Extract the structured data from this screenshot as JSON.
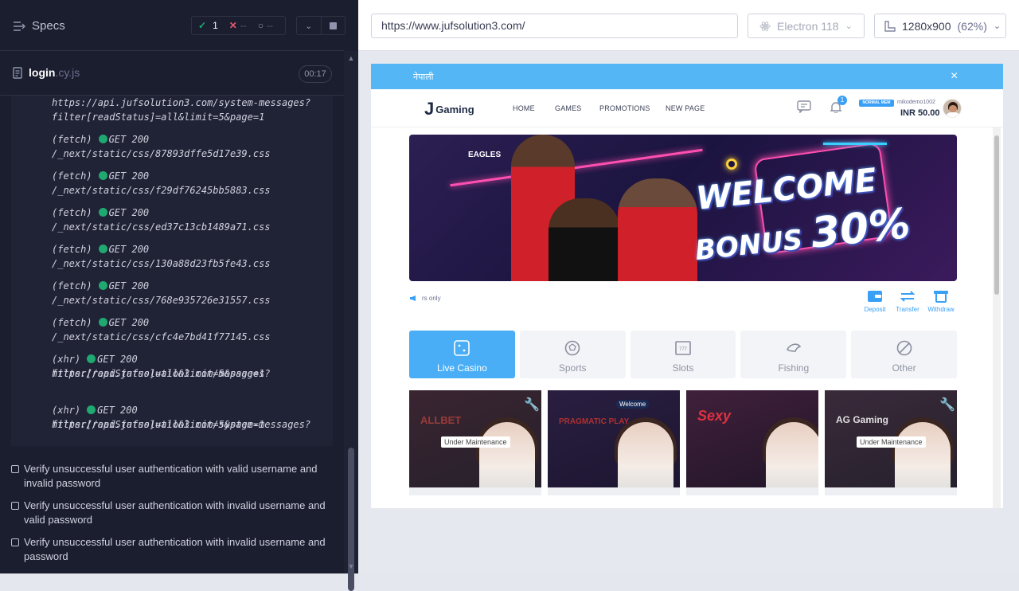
{
  "runner": {
    "title": "Specs",
    "stats": {
      "passed": "1",
      "failed": "--",
      "pending": "--"
    },
    "file": {
      "name": "login",
      "ext": ".cy.js"
    },
    "timer": "00:17",
    "log": [
      {
        "type": "",
        "method": "",
        "url": "https://api.jufsolution3.com/system-messages?"
      },
      {
        "type": "",
        "method": "",
        "url": "filter[readStatus]=all&limit=5&page=1"
      },
      {
        "type": "(fetch)",
        "method": "GET 200",
        "url": "/_next/static/css/87893dffe5d17e39.css"
      },
      {
        "type": "(fetch)",
        "method": "GET 200",
        "url": "/_next/static/css/f29df76245bb5883.css"
      },
      {
        "type": "(fetch)",
        "method": "GET 200",
        "url": "/_next/static/css/ed37c13cb1489a71.css"
      },
      {
        "type": "(fetch)",
        "method": "GET 200",
        "url": "/_next/static/css/130a88d23fb5fe43.css"
      },
      {
        "type": "(fetch)",
        "method": "GET 200",
        "url": "/_next/static/css/768e935726e31557.css"
      },
      {
        "type": "(fetch)",
        "method": "GET 200",
        "url": "/_next/static/css/cfc4e7bd41f77145.css"
      },
      {
        "type": "(xhr)",
        "method": "GET 200",
        "url": "https://api.jufsolution3.com/messages?"
      },
      {
        "type": "",
        "method": "",
        "url": "filter[readStatus]=all&limit=5&page=1"
      },
      {
        "type": "(xhr)",
        "method": "GET 200",
        "url": "https://api.jufsolution3.com/system-messages?"
      },
      {
        "type": "",
        "method": "",
        "url": "filter[readStatus]=all&limit=5&page=1"
      }
    ],
    "tests": [
      "Verify unsuccessful user authentication with valid username and invalid password",
      "Verify unsuccessful user authentication with invalid username and valid password",
      "Verify unsuccessful user authentication with invalid username and password"
    ]
  },
  "browser": {
    "url": "https://www.jufsolution3.com/",
    "engine": "Electron 118",
    "viewport": "1280x900",
    "zoom": "(62%)"
  },
  "site": {
    "banner_lang": "नेपाली",
    "banner_close": "×",
    "logo": "Gaming",
    "logo_mark": "J",
    "menu": [
      "HOME",
      "GAMES",
      "PROMOTIONS",
      "NEW PAGE"
    ],
    "notif_count": "1",
    "member_badge": "NORMAL MEM",
    "username": "mikodemo1002",
    "balance": "INR 50.00",
    "hero": {
      "welcome": "WELCOME",
      "bonus": "BONUS",
      "percent": "30%",
      "club": "EAGLES"
    },
    "ticker": "rs only",
    "quick_actions": [
      "Deposit",
      "Transfer",
      "Withdraw"
    ],
    "categories": [
      "Live Casino",
      "Sports",
      "Slots",
      "Fishing",
      "Other"
    ],
    "tiles": [
      {
        "name": "ALLBET",
        "status": "Under Maintenance"
      },
      {
        "name": "PRAGMATIC PLAY",
        "tag": "Welcome"
      },
      {
        "name": "Sexy"
      },
      {
        "name": "AG Gaming",
        "status": "Under Maintenance"
      }
    ]
  },
  "colors": {
    "accent": "#4aaef6",
    "banner": "#55b6f5",
    "runner_bg": "#1b1e2e",
    "pass": "#1fa971",
    "fail": "#e45770"
  }
}
